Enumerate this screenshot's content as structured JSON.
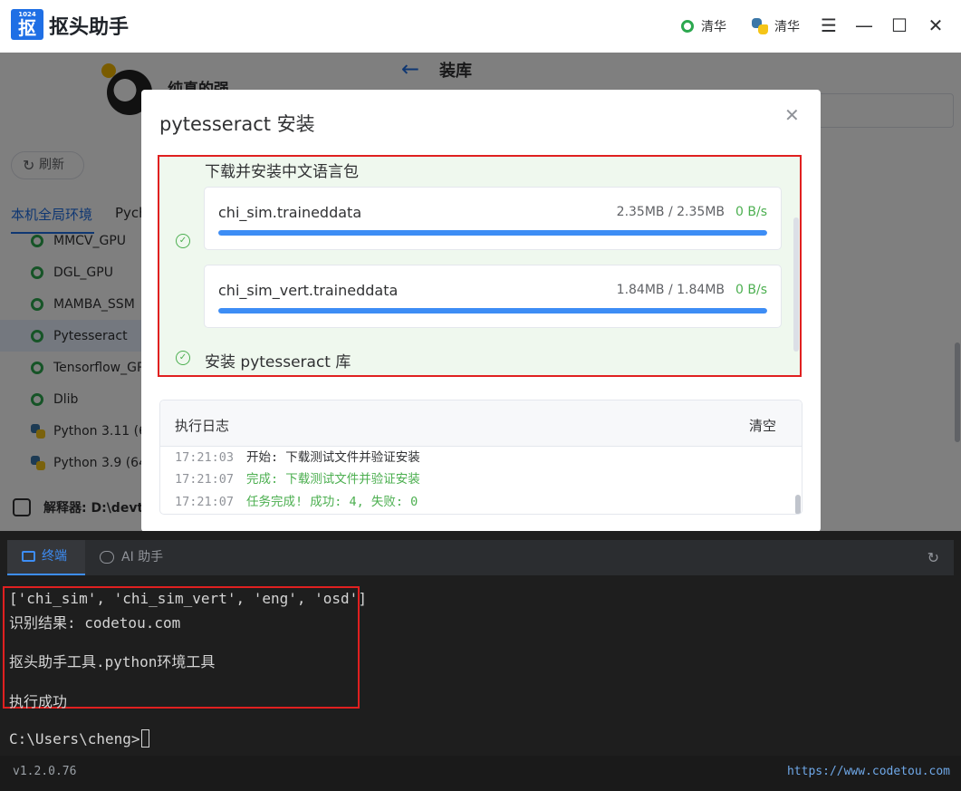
{
  "app": {
    "logo_number": "1024",
    "logo_char": "抠",
    "title": "抠头助手",
    "mirror1_label": "清华",
    "mirror2_label": "清华",
    "window_controls": {
      "menu": "☰",
      "minimize": "—",
      "maximize": "☐",
      "close": "✕"
    }
  },
  "background": {
    "username": "纯真的强",
    "page_title": "装库",
    "refresh_label": "刷新",
    "tabs": [
      "本机全局环境",
      "Pych"
    ],
    "env_items": [
      {
        "label": "MMCV_GPU",
        "icon": "status-ring-icon",
        "selected": false
      },
      {
        "label": "DGL_GPU",
        "icon": "status-ring-icon",
        "selected": false
      },
      {
        "label": "MAMBA_SSM",
        "icon": "status-ring-icon",
        "selected": false
      },
      {
        "label": "Pytesseract",
        "icon": "status-ring-icon",
        "selected": true
      },
      {
        "label": "Tensorflow_GP",
        "icon": "status-ring-icon",
        "selected": false
      },
      {
        "label": "Dlib",
        "icon": "status-ring-icon",
        "selected": false
      },
      {
        "label": "Python 3.11 (6",
        "icon": "python-icon",
        "selected": false
      },
      {
        "label": "Python 3.9 (64",
        "icon": "python-icon",
        "selected": false
      }
    ],
    "interpreter_label": "解释器: D:\\devt"
  },
  "modal": {
    "title": "pytesseract 安装",
    "close_glyph": "✕",
    "step1_title": "下载并安装中文语言包",
    "downloads": [
      {
        "name": "chi_sim.traineddata",
        "size": "2.35MB / 2.35MB",
        "speed": "0 B/s",
        "progress": 1.0
      },
      {
        "name": "chi_sim_vert.traineddata",
        "size": "1.84MB / 1.84MB",
        "speed": "0 B/s",
        "progress": 1.0
      }
    ],
    "step2_title": "安装 pytesseract 库",
    "log": {
      "title": "执行日志",
      "clear_label": "清空",
      "lines": [
        {
          "time": "17:21:03",
          "text": "开始: 下载测试文件并验证安装",
          "color": "#303133"
        },
        {
          "time": "17:21:07",
          "text": "完成: 下载测试文件并验证安装",
          "color": "#4caf50"
        },
        {
          "time": "17:21:07",
          "text": "任务完成! 成功: 4, 失败: 0",
          "color": "#4caf50"
        }
      ]
    }
  },
  "terminal": {
    "tab_terminal": "终端",
    "tab_ai": "AI 助手",
    "lines": [
      "['chi_sim', 'chi_sim_vert', 'eng', 'osd']",
      "识别结果: codetou.com",
      "",
      "抠头助手工具.python环境工具",
      "",
      "执行成功",
      "",
      "C:\\Users\\cheng>"
    ]
  },
  "footer": {
    "version": "v1.2.0.76",
    "website": "https://www.codetou.com"
  },
  "colors": {
    "accent": "#1f6fe5",
    "success": "#4caf50",
    "highlight_border": "#e02020",
    "progress": "#3d8df5"
  }
}
